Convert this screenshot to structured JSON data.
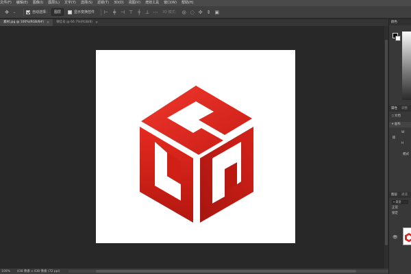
{
  "menu": [
    "文件(F)",
    "编辑(E)",
    "图像(I)",
    "图层(L)",
    "文字(Y)",
    "选择(S)",
    "滤镜(T)",
    "3D(D)",
    "视图(V)",
    "增效工具",
    "窗口(W)",
    "帮助(H)"
  ],
  "options": {
    "auto_select_label": "自动选择：",
    "layer_dropdown": "图层",
    "show_transform_label": "显示变换控件",
    "mode_3d_label": "3D 模式："
  },
  "tabs": [
    {
      "label": "素材.jpg @ 100%(RGB/8#)",
      "close": "×"
    },
    {
      "label": "微信号 @ 66.7%(RGB/8)",
      "close": "×"
    }
  ],
  "status": {
    "zoom": "100%",
    "doc_info": "438 像素 x 438 像素 (72 ppi)"
  },
  "panels": {
    "color_tab": "颜色",
    "properties_tab": "属性",
    "properties_tab2": "调整",
    "doc_label": "文档",
    "canvas_label": "画布",
    "w_label": "W",
    "h_label": "H",
    "mode_label": "模式",
    "layers_tab": "图层",
    "layers_tab2": "通道",
    "kind_label": "类型",
    "normal_label": "正常",
    "lock_label": "锁定"
  },
  "colors": {
    "logo_red": "#e0231b",
    "logo_dark": "#b81a14",
    "canvas_bg": "#282828",
    "document_bg": "#ffffff"
  },
  "icons": [
    "move-icon",
    "checkbox-icon",
    "align-icon",
    "3d-orbit-icon",
    "eye-icon"
  ]
}
